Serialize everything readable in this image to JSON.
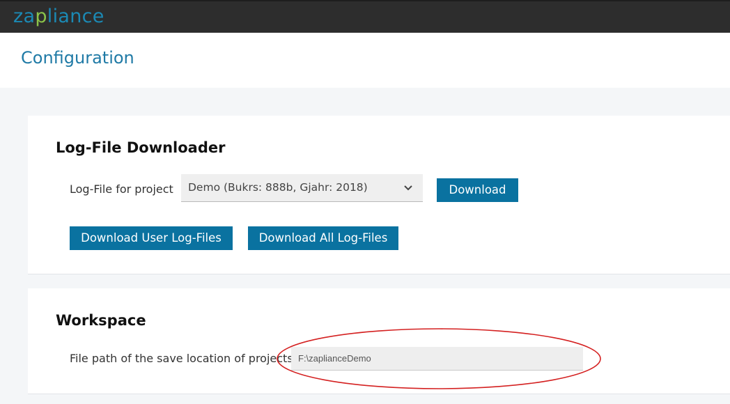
{
  "app": {
    "logo_prefix": "za",
    "logo_accent": "p",
    "logo_suffix": "liance",
    "logo_color": "#1b89b4",
    "logo_accent_color": "#8bc34a"
  },
  "page": {
    "title": "Configuration"
  },
  "logfile_section": {
    "title": "Log-File Downloader",
    "project_label": "Log-File for project",
    "project_selected": "Demo (Bukrs: 888b, Gjahr: 2018)",
    "download_button": "Download",
    "download_user_button": "Download User Log-Files",
    "download_all_button": "Download All Log-Files"
  },
  "workspace_section": {
    "title": "Workspace",
    "path_label": "File path of the save location of projects",
    "path_value": "F:\\zaplianceDemo"
  },
  "colors": {
    "topbar": "#2d2d2d",
    "primary_button": "#0a72a0",
    "title_blue": "#1f7aa6",
    "annotation_red": "#d42020"
  },
  "icons": {
    "select_chevron": "chevron-down-icon"
  }
}
